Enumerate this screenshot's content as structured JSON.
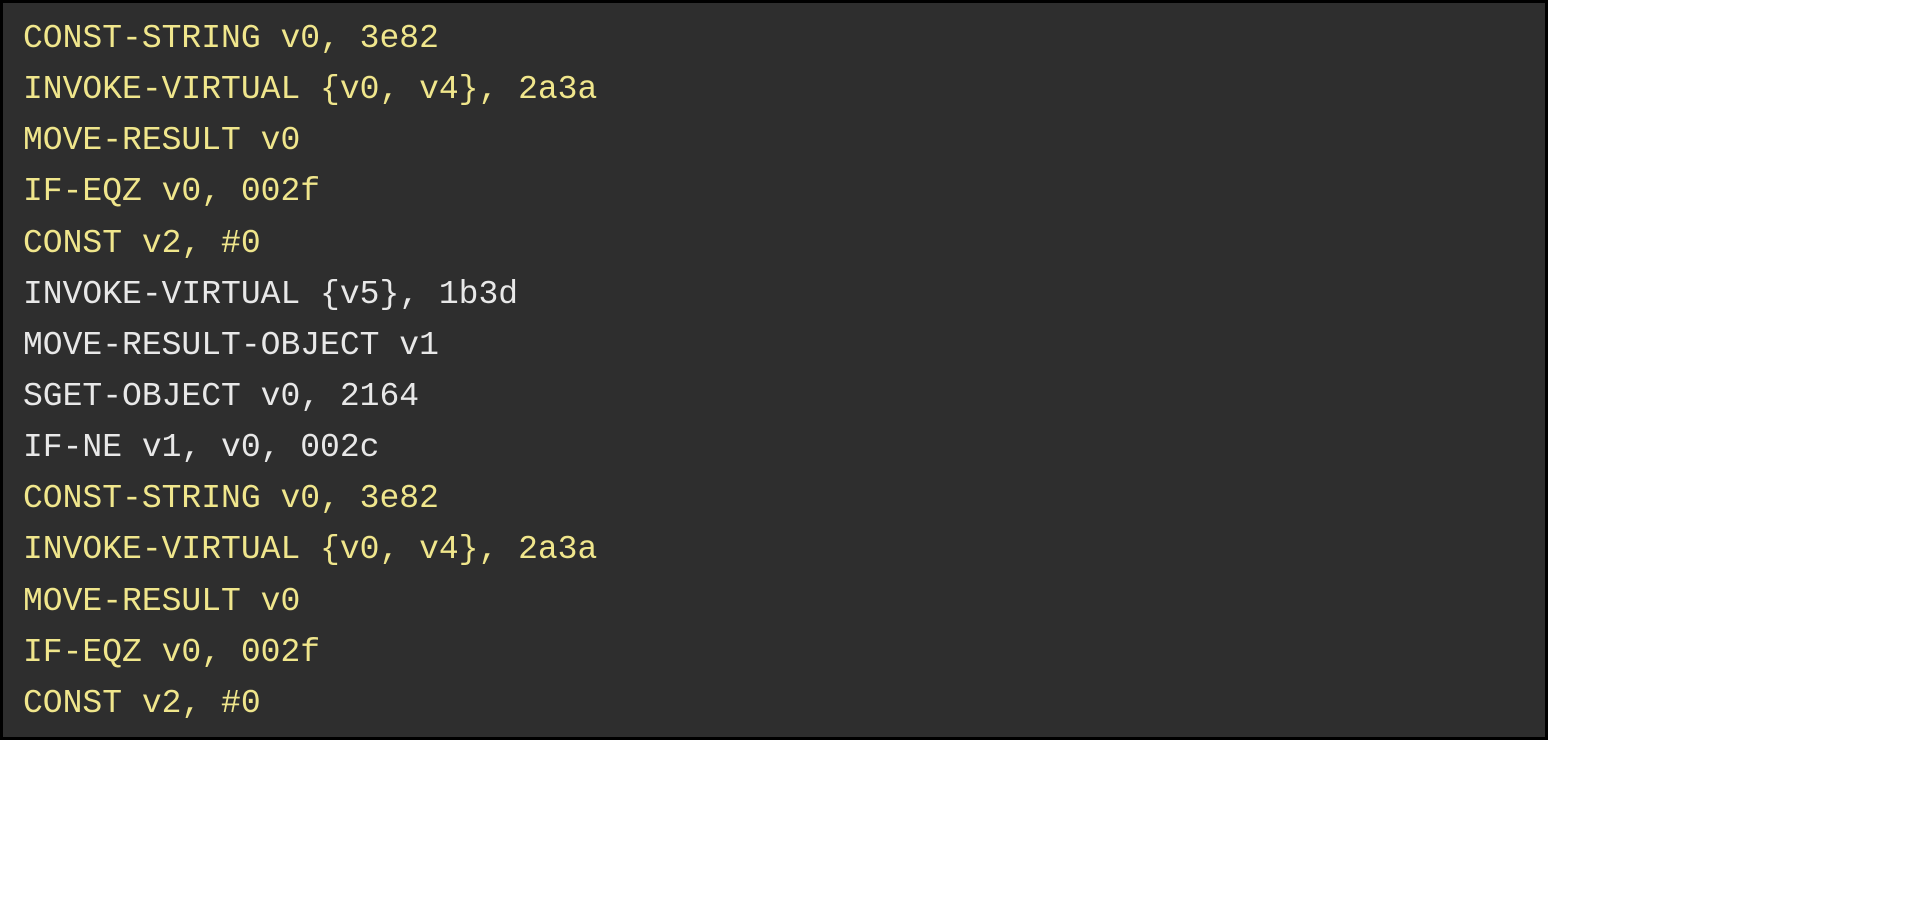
{
  "code": {
    "lines": [
      {
        "text": "CONST-STRING v0, 3e82",
        "highlighted": true
      },
      {
        "text": "INVOKE-VIRTUAL {v0, v4}, 2a3a",
        "highlighted": true
      },
      {
        "text": "MOVE-RESULT v0",
        "highlighted": true
      },
      {
        "text": "IF-EQZ v0, 002f",
        "highlighted": true
      },
      {
        "text": "CONST v2, #0",
        "highlighted": true
      },
      {
        "text": "INVOKE-VIRTUAL {v5}, 1b3d",
        "highlighted": false
      },
      {
        "text": "MOVE-RESULT-OBJECT v1",
        "highlighted": false
      },
      {
        "text": "SGET-OBJECT v0, 2164",
        "highlighted": false
      },
      {
        "text": "IF-NE v1, v0, 002c",
        "highlighted": false
      },
      {
        "text": "CONST-STRING v0, 3e82",
        "highlighted": true
      },
      {
        "text": "INVOKE-VIRTUAL {v0, v4}, 2a3a",
        "highlighted": true
      },
      {
        "text": "MOVE-RESULT v0",
        "highlighted": true
      },
      {
        "text": "IF-EQZ v0, 002f",
        "highlighted": true
      },
      {
        "text": "CONST v2, #0",
        "highlighted": true
      }
    ]
  },
  "colors": {
    "background": "#2e2e2e",
    "border": "#000000",
    "highlight": "#f0e68c",
    "normal": "#e8e8e8"
  }
}
